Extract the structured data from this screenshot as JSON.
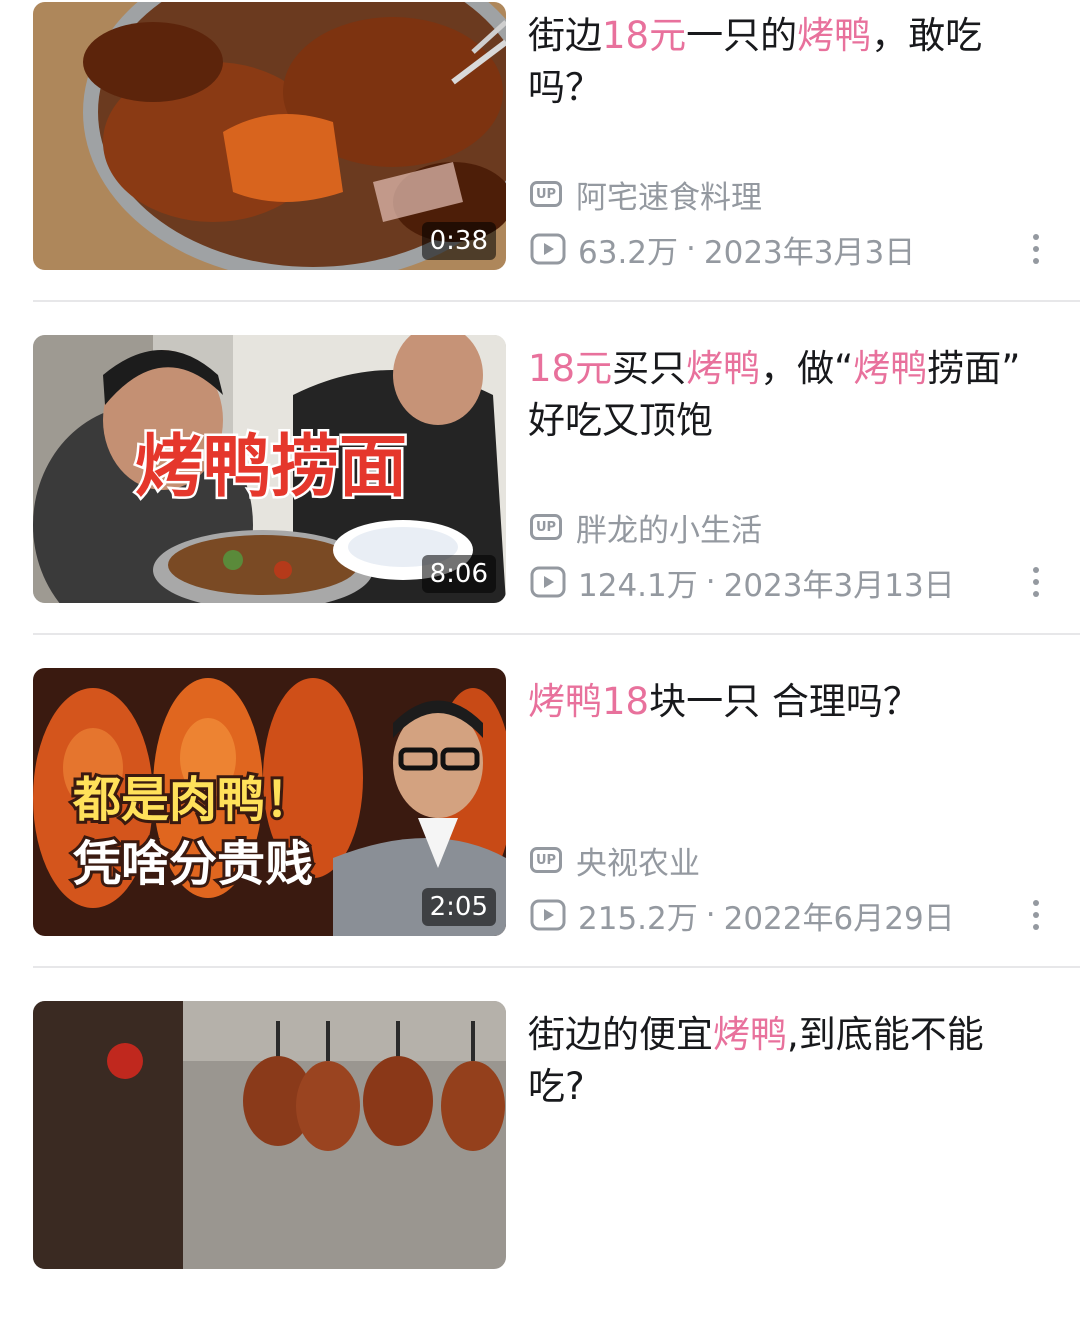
{
  "items": [
    {
      "title": [
        {
          "t": "街边"
        },
        {
          "t": "18元",
          "hl": true
        },
        {
          "t": "一只的"
        },
        {
          "t": "烤鸭",
          "hl": true
        },
        {
          "t": "，敢吃\n吗？"
        }
      ],
      "duration": "0:38",
      "uploader": "阿宅速食料理",
      "views": "63.2万",
      "date": "2023年3月3日"
    },
    {
      "title": [
        {
          "t": "18元",
          "hl": true
        },
        {
          "t": "买只"
        },
        {
          "t": "烤鸭",
          "hl": true
        },
        {
          "t": "，做“"
        },
        {
          "t": "烤鸭",
          "hl": true
        },
        {
          "t": "捞面”\n好吃又顶饱"
        }
      ],
      "thumb_text": "烤鸭捞面",
      "duration": "8:06",
      "uploader": "胖龙的小生活",
      "views": "124.1万",
      "date": "2023年3月13日"
    },
    {
      "title": [
        {
          "t": "烤鸭18",
          "hl": true
        },
        {
          "t": "块一只 合理吗？"
        }
      ],
      "thumb_text_1": "都是肉鸭！",
      "thumb_text_2": "凭啥分贵贱",
      "duration": "2:05",
      "uploader": "央视农业",
      "views": "215.2万",
      "date": "2022年6月29日"
    },
    {
      "title": [
        {
          "t": "街边的便宜"
        },
        {
          "t": "烤鸭",
          "hl": true
        },
        {
          "t": ",到底能不能\n吃?"
        }
      ]
    }
  ],
  "up_badge": "UP",
  "separator": "·",
  "colors": {
    "highlight": "#e8719c",
    "meta": "#9499a0",
    "divider": "#e7e7e9"
  }
}
